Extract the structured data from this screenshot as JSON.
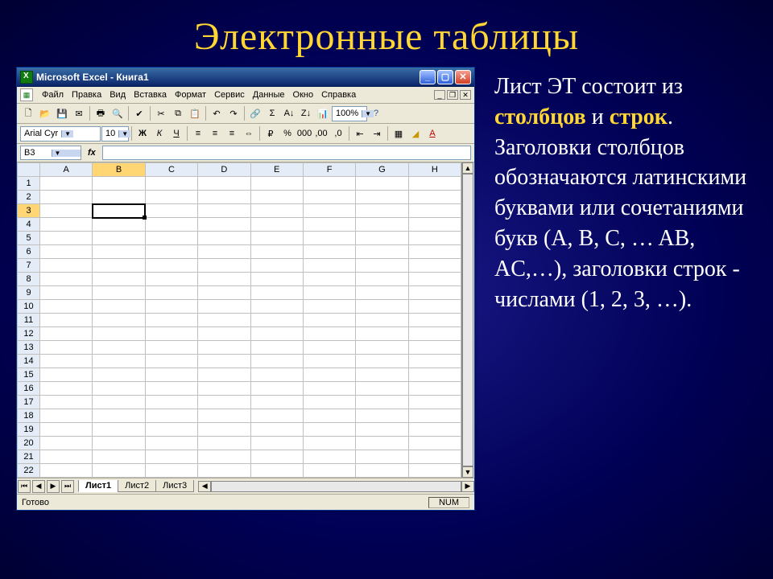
{
  "slide": {
    "title": "Электронные таблицы",
    "desc_parts": {
      "p1": "Лист ЭТ состоит из ",
      "hl1": "столбцов",
      "p2": " и ",
      "hl2": "строк",
      "p3": ". Заголовки столбцов обозначаются латинскими буквами или сочетаниями букв (A, B, C, … AB, AC,…), заголовки строк  - числами (1, 2, 3, …)."
    }
  },
  "excel": {
    "title": "Microsoft Excel - Книга1",
    "menus": [
      "Файл",
      "Правка",
      "Вид",
      "Вставка",
      "Формат",
      "Сервис",
      "Данные",
      "Окно",
      "Справка"
    ],
    "font": "Arial Cyr",
    "font_size": "10",
    "zoom": "100%",
    "name_box": "B3",
    "columns": [
      "A",
      "B",
      "C",
      "D",
      "E",
      "F",
      "G",
      "H"
    ],
    "row_count": 22,
    "active_cell": {
      "row": 3,
      "col": "B"
    },
    "sheets": [
      "Лист1",
      "Лист2",
      "Лист3"
    ],
    "active_sheet": 0,
    "status": "Готово",
    "status_num": "NUM"
  },
  "toolbar1_icons": [
    "new",
    "open",
    "save",
    "mail",
    "print",
    "preview",
    "spell",
    "cut",
    "copy",
    "paste",
    "undo",
    "redo",
    "link",
    "autosum",
    "sort-asc",
    "sort-desc",
    "chart"
  ],
  "toolbar2_icons": [
    "bold",
    "italic",
    "underline",
    "align-left",
    "align-center",
    "align-right",
    "merge",
    "currency",
    "percent",
    "comma",
    "inc-dec",
    "dec-dec",
    "indent-left",
    "indent-right",
    "border",
    "fill",
    "font-color"
  ]
}
